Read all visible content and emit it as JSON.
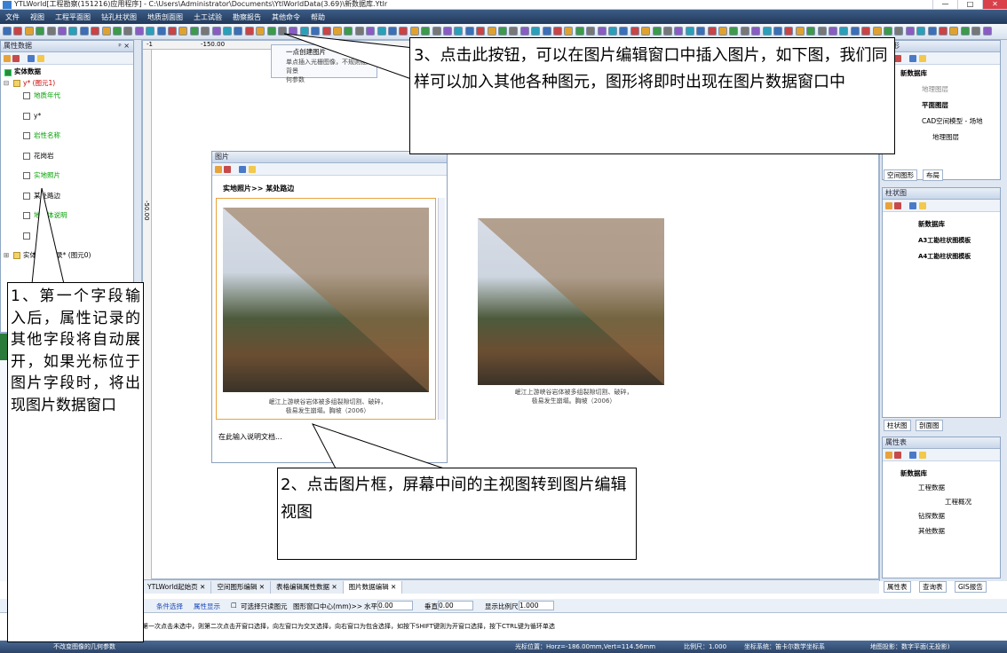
{
  "window": {
    "title": "YTLWorld[工程勘察(151216)应用程序] - C:\\Users\\Administrator\\Documents\\YtlWorldData(3.69)\\新数据库.Ytlr",
    "min": "—",
    "max": "□",
    "close": "✕"
  },
  "menu": [
    "文件",
    "视图",
    "工程平面图",
    "钻孔柱状图",
    "地质剖面图",
    "土工试验",
    "勘察报告",
    "其他命令",
    "帮助"
  ],
  "left_panel": {
    "title": "属性数据",
    "pin": "ᵖ ×",
    "root": "实体数据",
    "record_group": "y* (图元1)",
    "fields": [
      {
        "label": "地质年代",
        "color": "#00a000"
      },
      {
        "label": "y*",
        "color": "#000"
      },
      {
        "label": "岩性名称",
        "color": "#00a000"
      },
      {
        "label": "花岗岩",
        "color": "#000"
      },
      {
        "label": "实地照片",
        "color": "#00a000"
      },
      {
        "label": "某处路边",
        "color": "#000"
      },
      {
        "label": "地质体说明",
        "color": "#00a000"
      },
      {
        "label": "",
        "color": "#000"
      }
    ],
    "last_node": "实体 · 新记录* (图元0)"
  },
  "ruler": {
    "mark_left": "-1",
    "mark_mid": "-150.00",
    "side": "-50.00"
  },
  "tooltip": {
    "title": "一点创建图片",
    "body": "单点插入光栅图像，不规则插入背景\n何参数"
  },
  "image_panel": {
    "title": "图片",
    "breadcrumb": "实地照片>> 某处路边",
    "caption": "岷江上游峡谷岩体被多组裂隙切割、破碎，\n极易发生崩塌。胸坡（2006）",
    "notes": "在此输入说明文档..."
  },
  "main_image_caption": "岷江上游峡谷岩体被多组裂隙切割、破碎，\n极易发生崩塌。胸坡（2006）",
  "callouts": {
    "c1": "1、第一个字段输入后，属性记录的其他字段将自动展开，如果光标位于图片字段时，将出现图片数据窗口",
    "c2": "2、点击图片框，屏幕中间的主视图转到图片编辑视图",
    "c3": "3、点击此按钮，可以在图片编辑窗口中插入图片，如下图，我们同样可以加入其他各种图元，图形将即时出现在图片数据窗口中"
  },
  "right_panels": {
    "graph": {
      "title": "图形",
      "items": [
        "新数据库",
        "地理图层",
        "平面图层",
        "CAD空间模型 - 场地",
        "地理图层"
      ],
      "tabs": [
        "空间图形",
        "布局"
      ]
    },
    "column": {
      "title": "柱状图",
      "items": [
        "新数据库",
        "A3工勘柱状图模板",
        "A4工勘柱状图模板"
      ],
      "tabs": [
        "柱状图",
        "剖面图"
      ]
    },
    "attr": {
      "title": "属性表",
      "items": [
        "新数据库",
        "工程数据",
        "工程概况",
        "钻探数据",
        "其他数据"
      ],
      "tabs": [
        "属性表",
        "查询表",
        "GIS报告"
      ]
    }
  },
  "doc_tabs": [
    {
      "label": "YTLWorld起始页",
      "active": false
    },
    {
      "label": "空间图形编辑",
      "active": false
    },
    {
      "label": "表格编辑属性数据",
      "active": false
    },
    {
      "label": "图片数据编辑",
      "active": true
    }
  ],
  "options_bar": {
    "cond_select": "条件选择",
    "attr_show": "属性显示",
    "readonly": "可选择只读图元",
    "center_label": "图形窗口中心(mm)>>",
    "h_label": "水平",
    "h_value": "0.00",
    "v_label": "垂直",
    "v_value": "0.00",
    "scale_label": "显示比例尺",
    "scale_value": "1.000"
  },
  "hint": "第一次点击未选中，则第二次点击开窗口选择，向左窗口为交叉选择，向右窗口为包含选择，如按下SHIFT键则为开窗口选择，按下CTRL键为循环单选",
  "status": {
    "left": "不改变图像的几何参数",
    "pos": "光标位置：Horz=-186.00mm,Vert=114.56mm",
    "scale": "比例尺：1.000",
    "coord": "坐标系统：笛卡尔数学坐标系",
    "proj": "地图投影：数字平面(无投影)"
  }
}
